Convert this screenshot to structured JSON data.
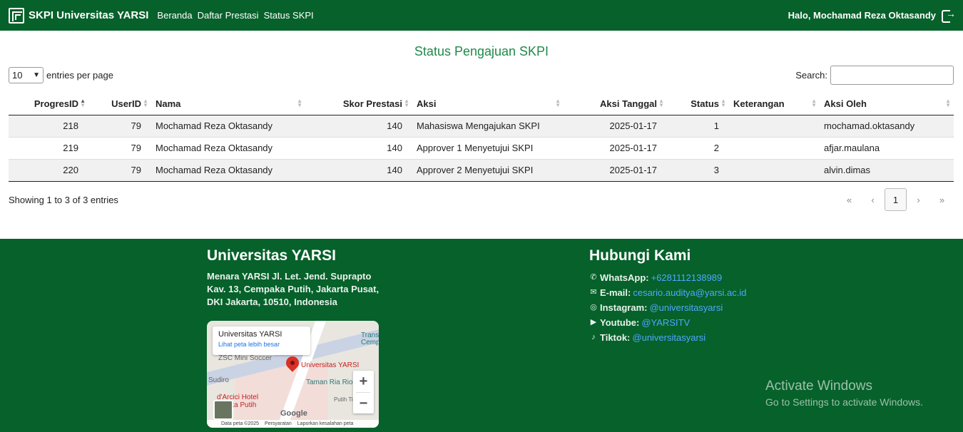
{
  "nav": {
    "brand": "SKPI Universitas YARSI",
    "links": [
      "Beranda",
      "Daftar Prestasi",
      "Status SKPI"
    ],
    "greeting": "Halo, Mochamad Reza Oktasandy"
  },
  "main": {
    "title": "Status Pengajuan SKPI",
    "entries_value": "10",
    "entries_label": "entries per page",
    "search_label": "Search:",
    "search_value": "",
    "columns": [
      "ProgresID",
      "UserID",
      "Nama",
      "Skor Prestasi",
      "Aksi",
      "Aksi Tanggal",
      "Status",
      "Keterangan",
      "Aksi Oleh"
    ],
    "rows": [
      [
        "218",
        "79",
        "Mochamad Reza Oktasandy",
        "140",
        "Mahasiswa Mengajukan SKPI",
        "2025-01-17",
        "1",
        "",
        "mochamad.oktasandy"
      ],
      [
        "219",
        "79",
        "Mochamad Reza Oktasandy",
        "140",
        "Approver 1 Menyetujui SKPI",
        "2025-01-17",
        "2",
        "",
        "afjar.maulana"
      ],
      [
        "220",
        "79",
        "Mochamad Reza Oktasandy",
        "140",
        "Approver 2 Menyetujui SKPI",
        "2025-01-17",
        "3",
        "",
        "alvin.dimas"
      ]
    ],
    "info": "Showing 1 to 3 of 3 entries",
    "pager": [
      "«",
      "‹",
      "1",
      "›",
      "»"
    ]
  },
  "footer": {
    "title": "Universitas YARSI",
    "address": "Menara YARSI Jl. Let. Jend. Suprapto Kav. 13, Cempaka Putih, Jakarta Pusat, DKI Jakarta, 10510, Indonesia",
    "map": {
      "card_title": "Universitas YARSI",
      "card_link": "Lihat peta lebih besar",
      "pin_label": "Universitas YARSI",
      "labels": [
        "ZSC Mini Soccer",
        "Taman Ria Rio",
        "d'Arcici Hotel",
        "paka Putih",
        "Sudiro",
        "Trans",
        "Cemp",
        "Putih Timi",
        "Google"
      ],
      "bar": [
        "Data peta ©2025",
        "Persyaratan",
        "Laporkan kesalahan peta"
      ]
    },
    "contact_title": "Hubungi Kami",
    "contacts": [
      {
        "icon": "whatsapp-icon",
        "label": "WhatsApp:",
        "value": "+6281112138989"
      },
      {
        "icon": "email-icon",
        "label": "E-mail:",
        "value": "cesario.auditya@yarsi.ac.id"
      },
      {
        "icon": "instagram-icon",
        "label": "Instagram:",
        "value": "@universitasyarsi"
      },
      {
        "icon": "youtube-icon",
        "label": "Youtube:",
        "value": "@YARSITV"
      },
      {
        "icon": "tiktok-icon",
        "label": "Tiktok:",
        "value": "@universitasyarsi"
      }
    ]
  },
  "watermark": {
    "line1": "Activate Windows",
    "line2": "Go to Settings to activate Windows."
  },
  "colors": {
    "nav_bg": "#06612a",
    "title": "#1e8a4a",
    "link": "#4fa8ff"
  }
}
